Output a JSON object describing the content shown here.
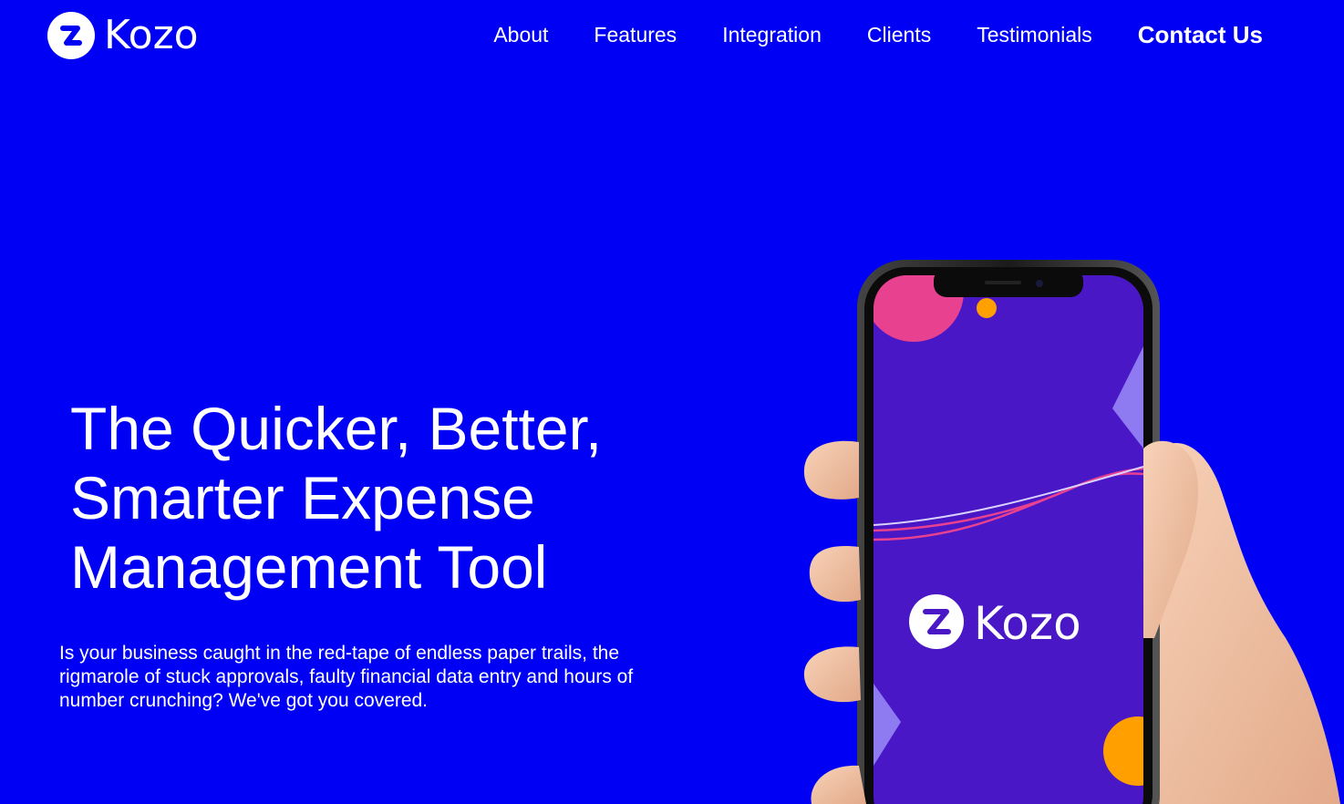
{
  "brand": {
    "name": "Kozo",
    "colors": {
      "background": "#0000F5",
      "text": "#FFFFFF",
      "phone_screen": "#4A17C6",
      "accent_pink": "#E8418F",
      "accent_orange": "#FFA000",
      "accent_violet": "#8E7BF2"
    }
  },
  "nav": {
    "items": [
      {
        "label": "About"
      },
      {
        "label": "Features"
      },
      {
        "label": "Integration"
      },
      {
        "label": "Clients"
      },
      {
        "label": "Testimonials"
      },
      {
        "label": "Contact Us"
      }
    ]
  },
  "hero": {
    "headline": "The Quicker, Better, Smarter Expense Management Tool",
    "subtext": "Is your business caught in the red-tape of endless paper trails, the rigmarole of stuck approvals, faulty financial data entry and hours of number crunching? We've got you covered.",
    "phone_screen_brand": "Kozo"
  },
  "icons": {
    "logo": "kozo-logo-icon",
    "phone": "phone-in-hand-illustration"
  }
}
